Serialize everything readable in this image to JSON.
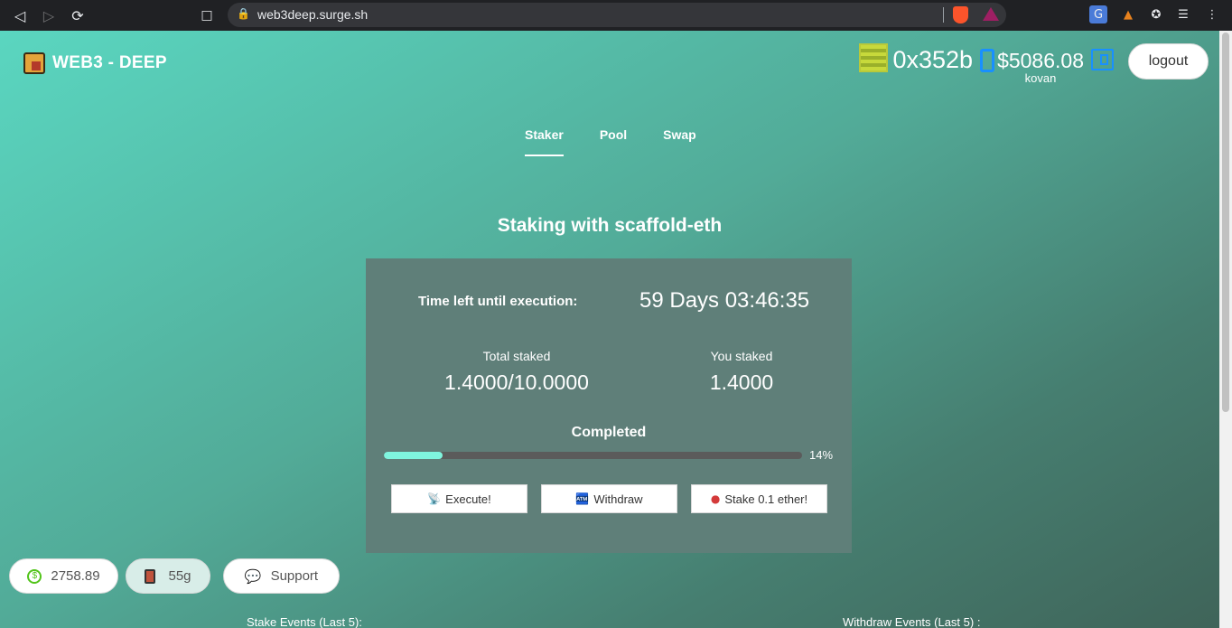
{
  "browser": {
    "url": "web3deep.surge.sh"
  },
  "app": {
    "logo_text": "WEB3 - DEEP",
    "account": {
      "address": "0x352b",
      "balance": "$5086.08",
      "network": "kovan",
      "logout_label": "logout"
    },
    "tabs": [
      {
        "label": "Staker",
        "active": true
      },
      {
        "label": "Pool",
        "active": false
      },
      {
        "label": "Swap",
        "active": false
      }
    ],
    "heading": "Staking with scaffold-eth",
    "card": {
      "time_label": "Time left until execution:",
      "time_value": "59 Days 03:46:35",
      "total_staked_label": "Total staked",
      "total_staked_value": "1.4000/10.0000",
      "you_staked_label": "You staked",
      "you_staked_value": "1.4000",
      "completed_label": "Completed",
      "progress_percent": 14,
      "progress_text": "14%",
      "buttons": [
        {
          "label": "Execute!",
          "icon": "satellite-icon"
        },
        {
          "label": "Withdraw",
          "icon": "atm-icon"
        },
        {
          "label": "Stake 0.1 ether!",
          "icon": "meat-icon"
        }
      ]
    },
    "footer": {
      "price": "2758.89",
      "gas": "55g",
      "support_label": "Support"
    },
    "events": {
      "stake_label": "Stake Events (Last 5):",
      "withdraw_label": "Withdraw Events (Last 5) :"
    }
  }
}
